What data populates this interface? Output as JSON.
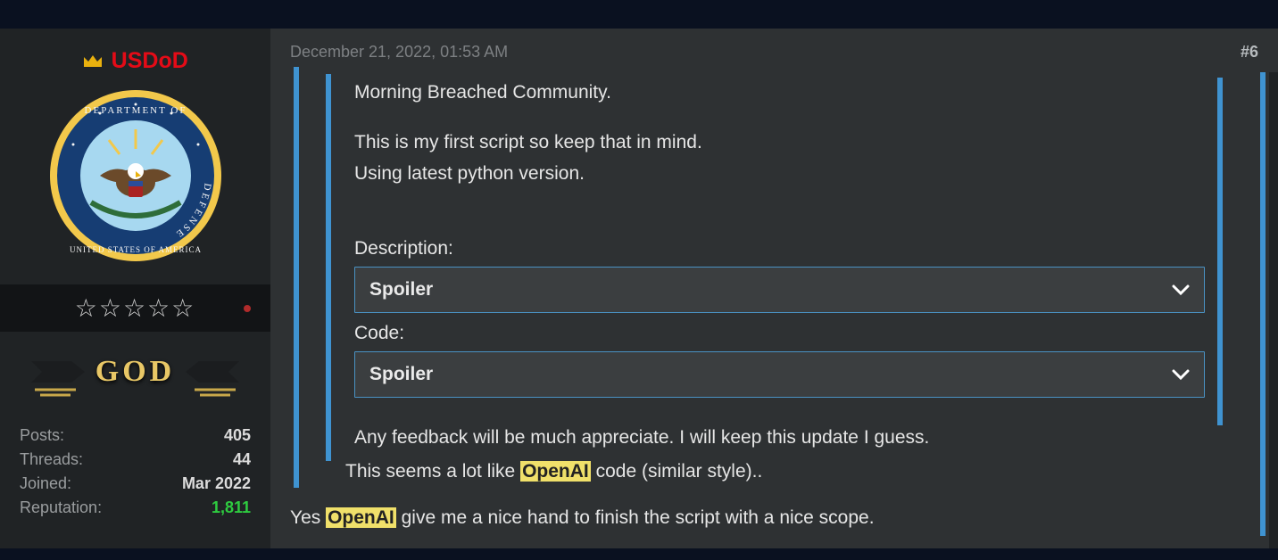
{
  "sidebar": {
    "username": "USDoD",
    "rank": "GOD",
    "star_count": 5,
    "stats": [
      {
        "label": "Posts:",
        "value": "405"
      },
      {
        "label": "Threads:",
        "value": "44"
      },
      {
        "label": "Joined:",
        "value": "Mar 2022"
      },
      {
        "label": "Reputation:",
        "value": "1,811",
        "green": true
      }
    ]
  },
  "post": {
    "timestamp": "December 21, 2022, 01:53 AM",
    "number": "#6",
    "quoted": {
      "lines": {
        "l1": "Morning Breached Community.",
        "l2": "This is my first script so keep that in mind.",
        "l3": "Using latest python version.",
        "desc_label": "Description:",
        "code_label": "Code:",
        "footer": "Any feedback will be much appreciate. I will keep this update I guess."
      },
      "spoiler_label": "Spoiler"
    },
    "inner_reply": {
      "before": "This seems a lot like ",
      "highlight": "OpenAI",
      "after": " code (similar style).."
    },
    "outer_reply": {
      "before": "Yes ",
      "highlight": "OpenAI",
      "after": " give me a nice hand to finish the script with a nice scope."
    }
  }
}
